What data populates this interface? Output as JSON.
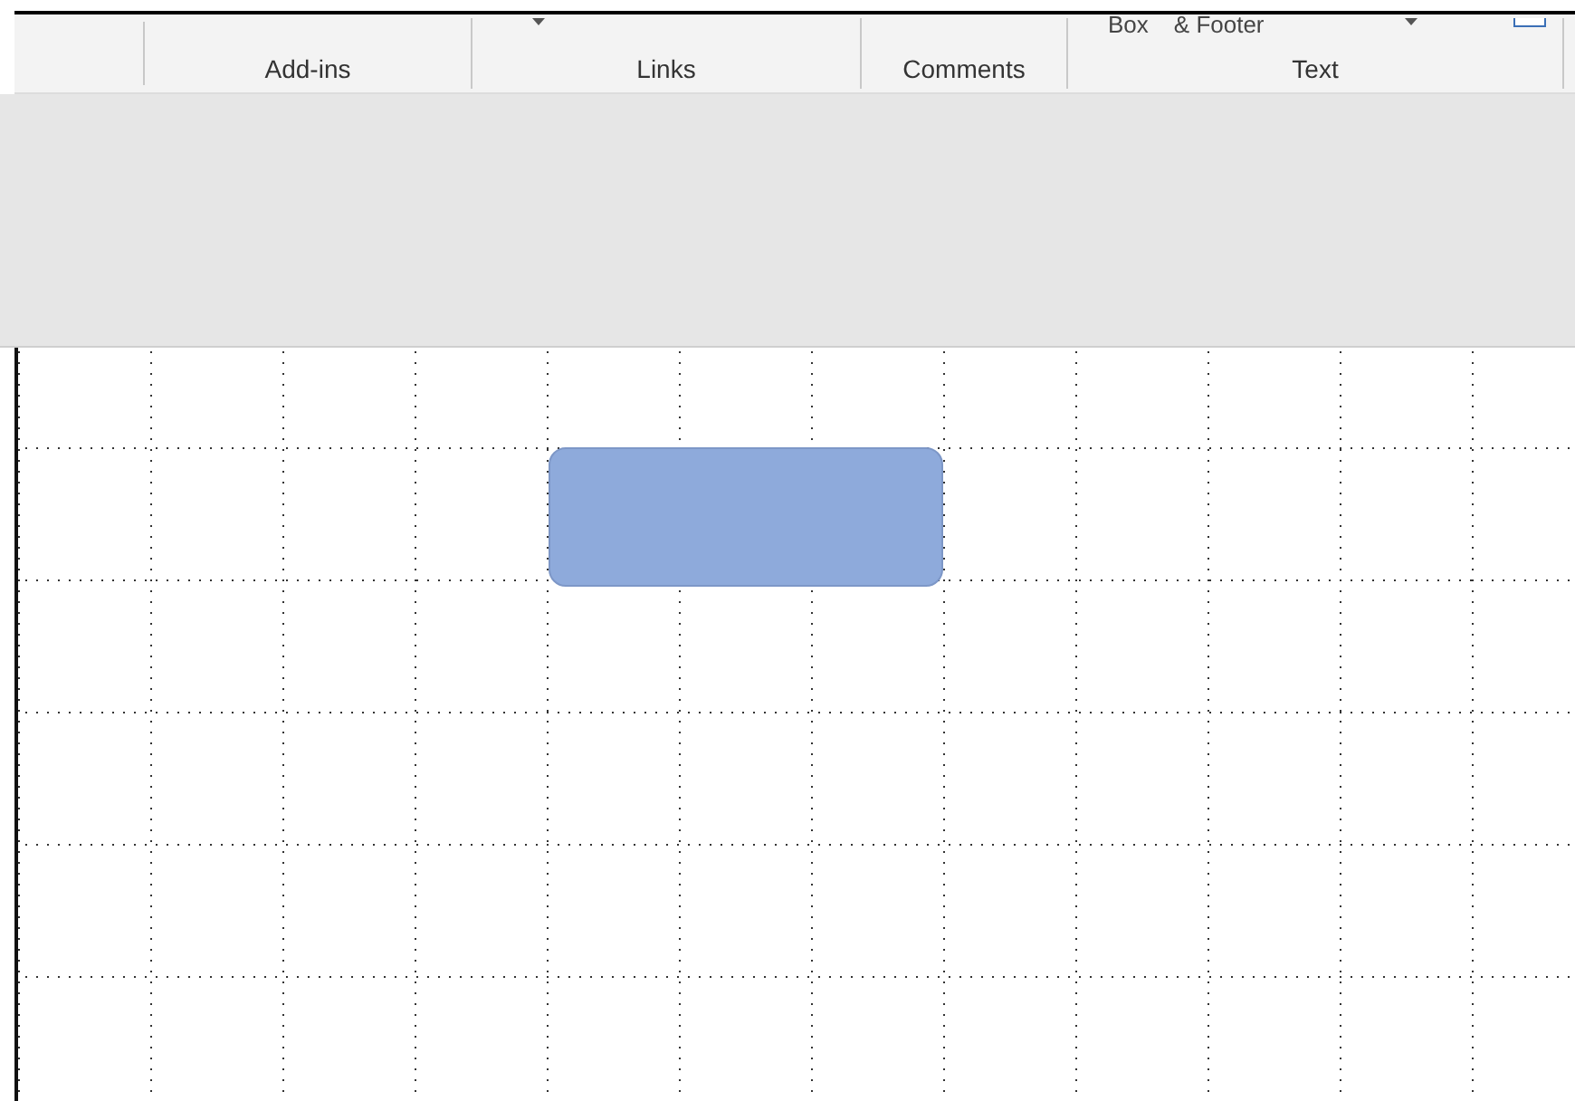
{
  "ribbon": {
    "groups": [
      {
        "label": "Add-ins",
        "caret": false
      },
      {
        "label": "Links",
        "caret": true
      },
      {
        "label": "Comments",
        "caret": false
      },
      {
        "label": "Text",
        "top_items": [
          "Box",
          "& Footer"
        ],
        "caret": true
      }
    ]
  },
  "canvas": {
    "shapes": [
      {
        "kind": "rounded-rectangle"
      }
    ]
  }
}
